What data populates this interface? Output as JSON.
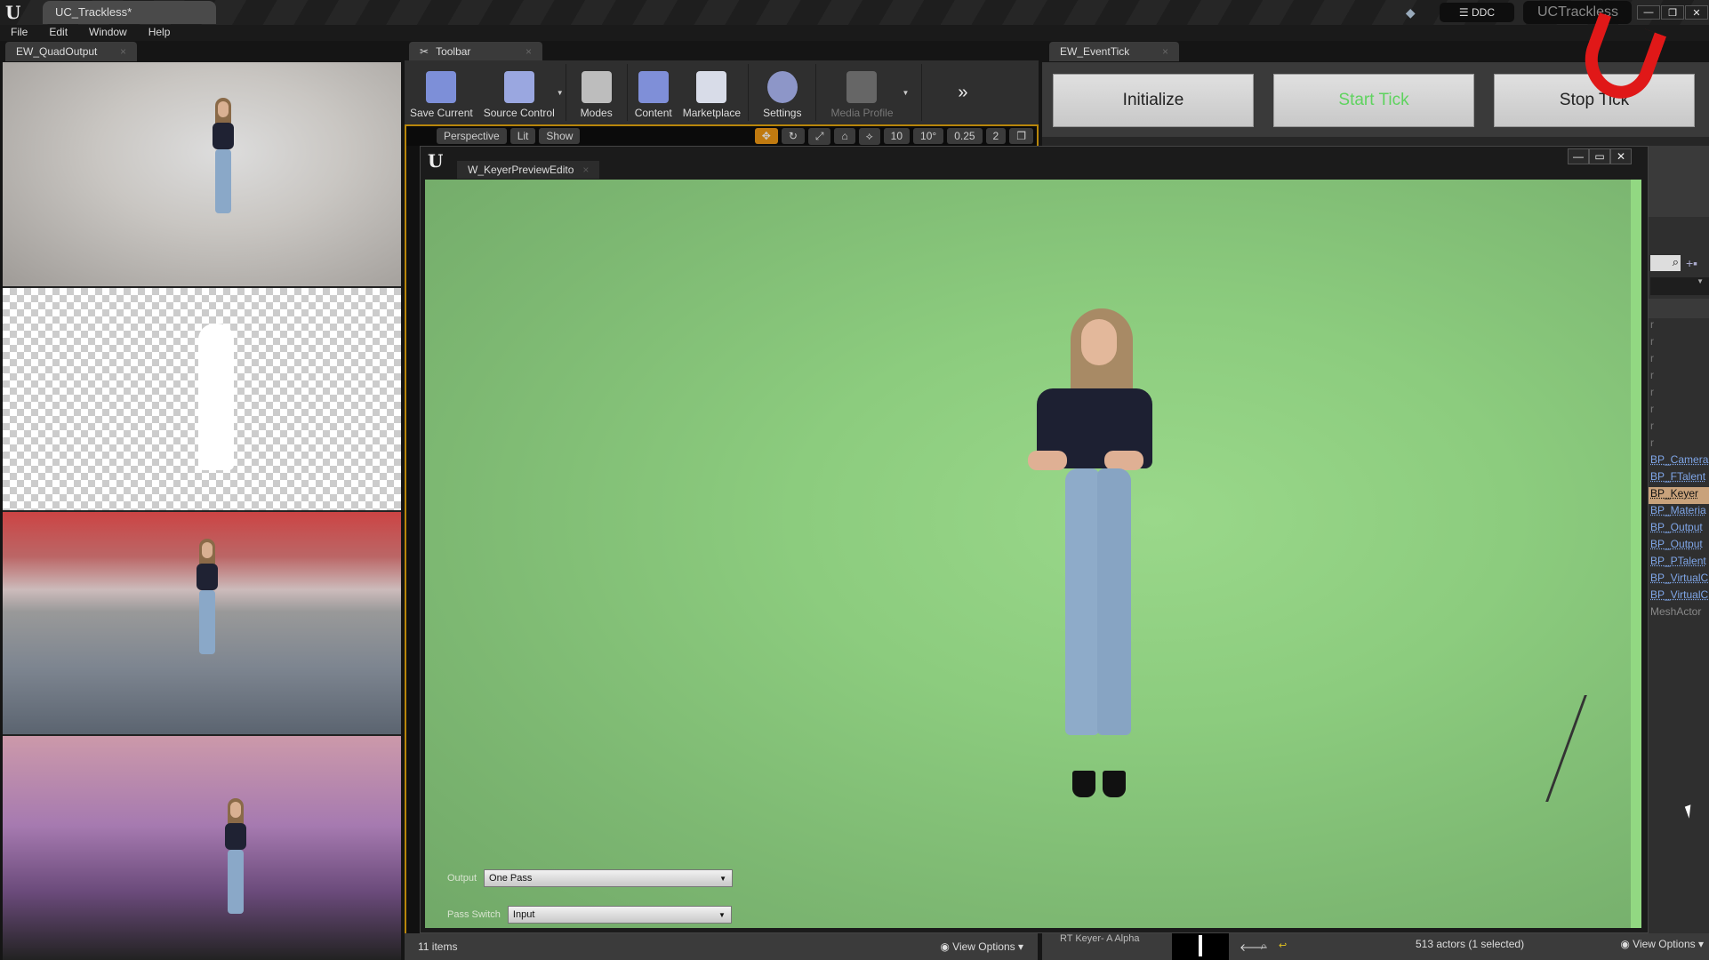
{
  "app": {
    "project_tab": "UC_Trackless*",
    "project_name": "UCTrackless",
    "ddc_label": "DDC"
  },
  "menu": [
    "File",
    "Edit",
    "Window",
    "Help"
  ],
  "quad_panel": {
    "tab_label": "EW_QuadOutput",
    "tiles": [
      "camera-input",
      "alpha-matte",
      "studio-composite",
      "city-composite"
    ]
  },
  "toolbar": {
    "tab_label": "Toolbar",
    "buttons": [
      {
        "label": "Save Current",
        "icon": "save-icon",
        "color": "#7d8fd8"
      },
      {
        "label": "Source Control",
        "icon": "source-control-icon",
        "color": "#9aa7e0"
      },
      {
        "label": "Modes",
        "icon": "modes-icon",
        "color": "#cfcfcf"
      },
      {
        "label": "Content",
        "icon": "content-icon",
        "color": "#7f8fd8"
      },
      {
        "label": "Marketplace",
        "icon": "marketplace-icon",
        "color": "#d8dce8"
      },
      {
        "label": "Settings",
        "icon": "settings-icon",
        "color": "#8d96c8"
      },
      {
        "label": "Media Profile",
        "icon": "media-profile-icon",
        "color": "#777777"
      }
    ]
  },
  "viewport_bar": {
    "perspective": "Perspective",
    "lit": "Lit",
    "show": "Show",
    "grid_snap": "10",
    "rot_snap": "10°",
    "scale_snap": "0.25",
    "camera_speed": "2"
  },
  "event_tick": {
    "tab_label": "EW_EventTick",
    "buttons": [
      "Initialize",
      "Start Tick",
      "Stop Tick"
    ],
    "start_color": "#5fd35f"
  },
  "keyer_window": {
    "tab_label": "W_KeyerPreviewEdito",
    "output_label": "Output",
    "output_value": "One Pass",
    "pass_switch_label": "Pass Switch",
    "pass_switch_value": "Input"
  },
  "status_left": {
    "items_count": "11 items",
    "view_options": "View Options"
  },
  "status_right": {
    "asset_label": "RT Keyer- A Alpha",
    "actor_count": "513 actors (1 selected)",
    "view_options": "View Options"
  },
  "outliner": {
    "items": [
      {
        "label": "BP_Camera",
        "selected": false
      },
      {
        "label": "BP_FTalent",
        "selected": false
      },
      {
        "label": "BP_Keyer",
        "selected": true
      },
      {
        "label": "BP_Materia",
        "selected": false
      },
      {
        "label": "BP_Output",
        "selected": false
      },
      {
        "label": "BP_Output",
        "selected": false
      },
      {
        "label": "BP_PTalent",
        "selected": false
      },
      {
        "label": "BP_VirtualC",
        "selected": false
      },
      {
        "label": "BP_VirtualC",
        "selected": false
      }
    ],
    "trailing": "MeshActor"
  }
}
